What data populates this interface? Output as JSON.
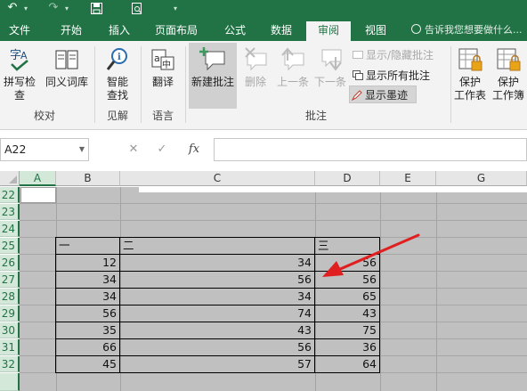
{
  "tabs": [
    "文件",
    "开始",
    "插入",
    "页面布局",
    "公式",
    "数据",
    "审阅",
    "视图"
  ],
  "tell_me": "告诉我您想要做什么...",
  "ribbon": {
    "spell_check": "拼写检查",
    "thesaurus": "同义词库",
    "smart_lookup_1": "智能",
    "smart_lookup_2": "查找",
    "translate": "翻译",
    "new_comment": "新建批注",
    "delete": "删除",
    "previous": "上一条",
    "next": "下一条",
    "show_hide_comment": "显示/隐藏批注",
    "show_all_comments": "显示所有批注",
    "show_ink": "显示墨迹",
    "protect_sheet_1": "保护",
    "protect_sheet_2": "工作表",
    "protect_workbook_1": "保护",
    "protect_workbook_2": "工作簿",
    "group_proofing": "校对",
    "group_insights": "见解",
    "group_language": "语言",
    "group_comments": "批注"
  },
  "formula_bar": {
    "name_box": "A22",
    "cancel": "✕",
    "enter": "✓",
    "fx": "fx",
    "value": ""
  },
  "columns": [
    "A",
    "B",
    "C",
    "D",
    "E",
    "G"
  ],
  "rows": [
    "22",
    "23",
    "24",
    "25",
    "26",
    "27",
    "28",
    "29",
    "30",
    "31",
    "32"
  ],
  "table": {
    "headers": [
      "一",
      "二",
      "三"
    ],
    "data": [
      [
        "12",
        "34",
        "56"
      ],
      [
        "34",
        "56",
        "56"
      ],
      [
        "34",
        "34",
        "65"
      ],
      [
        "56",
        "74",
        "43"
      ],
      [
        "35",
        "43",
        "75"
      ],
      [
        "66",
        "56",
        "36"
      ],
      [
        "45",
        "57",
        "64"
      ]
    ]
  },
  "colors": {
    "excel_green": "#217346",
    "ribbon_bg": "#f3f3f3",
    "grid_gray": "#c0c0c0",
    "arrow": "#e02020"
  }
}
